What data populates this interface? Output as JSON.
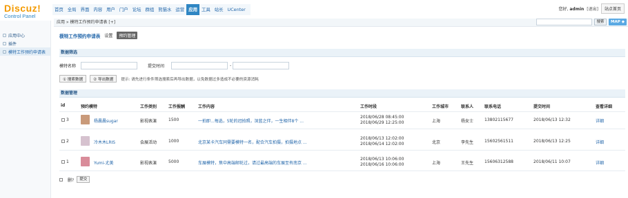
{
  "logo": {
    "main": "Discuz!",
    "sub": "Control Panel"
  },
  "topnav": [
    "首页",
    "全局",
    "界面",
    "内容",
    "用户",
    "门户",
    "论坛",
    "群组",
    "熊猫水",
    "运营",
    "应用",
    "工具",
    "站长",
    "UCenter"
  ],
  "topnav_active_index": 10,
  "user": {
    "greeting": "您好,",
    "name": "admin",
    "logout": "[退出]",
    "site": "站点首页"
  },
  "sidebar": {
    "items": [
      "应用中心",
      "插件",
      "模特工作预约申请表"
    ],
    "selected_index": 2
  },
  "breadcrumb": "应用 » 模特工作预约申请表 [+]",
  "search": {
    "button": "搜索",
    "map": "MAP ◆"
  },
  "title": {
    "main": "模特工作预约申请表",
    "tab1": "设置",
    "tab2": "预约管理"
  },
  "sections": {
    "filter": "数据筛选",
    "manage": "数据管理"
  },
  "filter": {
    "name_label": "模特名称",
    "time_label": "提交时间",
    "dash": "-"
  },
  "buttons": {
    "search": "① 搜索数据",
    "export": "② 导出数据",
    "tip": "提示: 请先进行条件筛选搜索后再导出数据，以免数据过多造成不必要的资源消耗"
  },
  "table": {
    "headers": [
      "id",
      "预约模特",
      "工作类别",
      "工作报酬",
      "工作内容",
      "工作时段",
      "工作城市",
      "联系人",
      "联系电话",
      "提交时间",
      "查看详细"
    ],
    "rows": [
      {
        "id": "3",
        "model": "杨晨晨sugar",
        "type": "影视表演",
        "pay": "1500",
        "content": "一拍即...每选，5轮的冠拍照，深蓝之伴，一生相伴8个 ...",
        "time1": "2018/06/28 08:45:00",
        "time2": "2018/06/29 12:25:00",
        "city": "上海",
        "contact": "杨女士",
        "phone": "13802115677",
        "submit": "2018/06/13 12:32",
        "detail": "详细",
        "avatar_color": "#c99a7a"
      },
      {
        "id": "2",
        "model": "冷木木LRIS",
        "type": "会展活动",
        "pay": "1000",
        "content": "北京某卡汽车同需要模特一名，配合汽车拍摄，拍摄地点 ...",
        "time1": "2018/06/13 12:02:00",
        "time2": "2018/06/14 12:02:00",
        "city": "北京",
        "contact": "李先生",
        "phone": "15602561511",
        "submit": "2018/06/13 12:25",
        "detail": "详细",
        "avatar_color": "#d6c2cf"
      },
      {
        "id": "1",
        "model": "Yumi-尤美",
        "type": "影视表演",
        "pay": "5000",
        "content": "车展模特，焦中高端邮轮过，请过最高端的车展至有南京 ...",
        "time1": "2018/06/13 10:06:00",
        "time2": "2018/06/16 10:06:00",
        "city": "上海",
        "contact": "王先生",
        "phone": "15606312588",
        "submit": "2018/06/11 10:07",
        "detail": "详细",
        "avatar_color": "#d98c9a"
      }
    ]
  },
  "bottom": {
    "delete_label": "删?",
    "submit": "提交"
  }
}
